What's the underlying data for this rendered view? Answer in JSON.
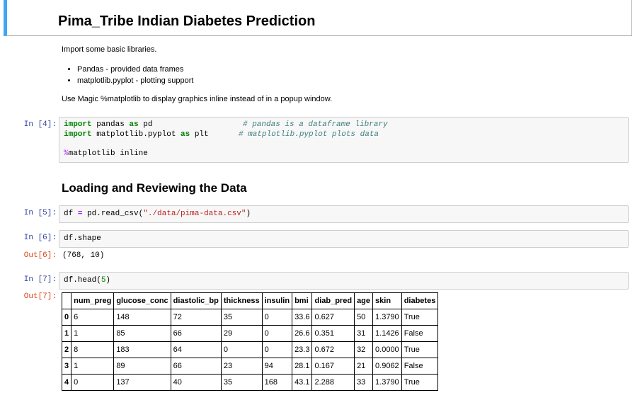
{
  "heading": "Pima_Tribe Indian Diabetes Prediction",
  "intro": "Import some basic libraries.",
  "bullets": [
    "Pandas - provided data frames",
    "matplotlib.pyplot - plotting support"
  ],
  "magic_note": "Use Magic %matplotlib to display graphics inline instead of in a popup window.",
  "cell4": {
    "prompt": "In [4]:",
    "l1_kw1": "import",
    "l1_mod": " pandas ",
    "l1_kw2": "as",
    "l1_alias": " pd",
    "l1_comment": "# pandas is a dataframe library",
    "l2_kw1": "import",
    "l2_mod": " matplotlib.pyplot ",
    "l2_kw2": "as",
    "l2_alias": " plt",
    "l2_comment": "# matplotlib.pyplot plots data",
    "l3_magic": "%",
    "l3_text": "matplotlib inline"
  },
  "section_heading": "Loading and Reviewing the Data",
  "cell5": {
    "prompt": "In [5]:",
    "code_a": "df ",
    "code_eq": "=",
    "code_b": " pd.read_csv(",
    "code_str": "\"./data/pima-data.csv\"",
    "code_c": ")"
  },
  "cell6": {
    "prompt": "In [6]:",
    "code": "df.shape",
    "out_prompt": "Out[6]:",
    "output": "(768, 10)"
  },
  "cell7": {
    "prompt": "In [7]:",
    "code_a": "df.head(",
    "code_num": "5",
    "code_b": ")",
    "out_prompt": "Out[7]:",
    "columns": [
      "",
      "num_preg",
      "glucose_conc",
      "diastolic_bp",
      "thickness",
      "insulin",
      "bmi",
      "diab_pred",
      "age",
      "skin",
      "diabetes"
    ],
    "rows": [
      [
        "0",
        "6",
        "148",
        "72",
        "35",
        "0",
        "33.6",
        "0.627",
        "50",
        "1.3790",
        "True"
      ],
      [
        "1",
        "1",
        "85",
        "66",
        "29",
        "0",
        "26.6",
        "0.351",
        "31",
        "1.1426",
        "False"
      ],
      [
        "2",
        "8",
        "183",
        "64",
        "0",
        "0",
        "23.3",
        "0.672",
        "32",
        "0.0000",
        "True"
      ],
      [
        "3",
        "1",
        "89",
        "66",
        "23",
        "94",
        "28.1",
        "0.167",
        "21",
        "0.9062",
        "False"
      ],
      [
        "4",
        "0",
        "137",
        "40",
        "35",
        "168",
        "43.1",
        "2.288",
        "33",
        "1.3790",
        "True"
      ]
    ]
  }
}
